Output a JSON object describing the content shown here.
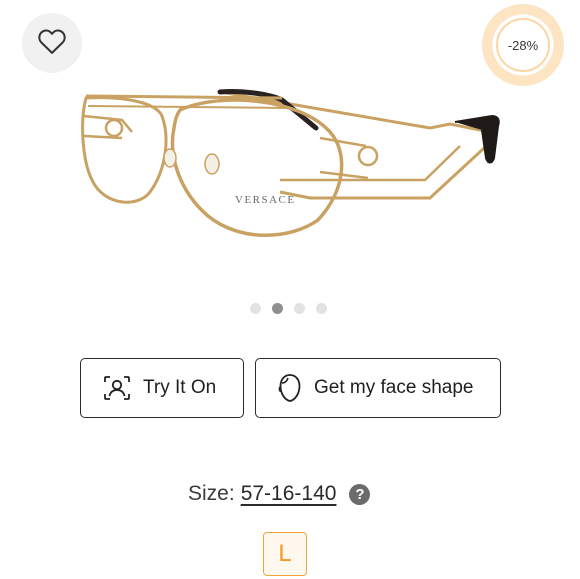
{
  "product": {
    "brand_on_frame": "VERSACE",
    "discount_label": "-28%",
    "image_icon": "eyeglasses-image",
    "carousel": {
      "count": 4,
      "active_index": 1
    }
  },
  "actions": {
    "try_on_label": "Try It On",
    "try_on_icon": "face-scan-icon",
    "face_shape_label": "Get my face shape",
    "face_shape_icon": "face-outline-icon"
  },
  "size": {
    "label": "Size:",
    "value": "57-16-140",
    "help_icon_text": "?",
    "selected_size": "L"
  },
  "wishlist": {
    "icon": "heart-outline-icon"
  },
  "colors": {
    "accent": "#f29a23",
    "badge_ring": "#fde5c4",
    "frame_gold": "#c9a263",
    "border": "#2b2b2b"
  }
}
